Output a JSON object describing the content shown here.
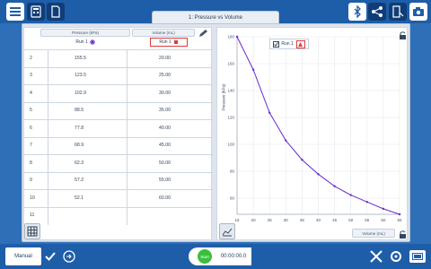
{
  "tab": {
    "title": "1: Pressure vs Volume"
  },
  "table": {
    "col1_header": "Pressure (kPa)",
    "col2_header": "Volume (mL)",
    "run1_label": "Run 1",
    "run2_label": "Run 1",
    "rows": [
      {
        "n": "2",
        "a": "155.5",
        "b": "20.00"
      },
      {
        "n": "3",
        "a": "123.5",
        "b": "25.00"
      },
      {
        "n": "4",
        "a": "102.9",
        "b": "30.00"
      },
      {
        "n": "5",
        "a": "88.5",
        "b": "35.00"
      },
      {
        "n": "6",
        "a": "77.8",
        "b": "40.00"
      },
      {
        "n": "7",
        "a": "68.9",
        "b": "45.00"
      },
      {
        "n": "8",
        "a": "62.3",
        "b": "50.00"
      },
      {
        "n": "9",
        "a": "57.2",
        "b": "55.00"
      },
      {
        "n": "10",
        "a": "52.1",
        "b": "60.00"
      },
      {
        "n": "11",
        "a": "",
        "b": ""
      }
    ]
  },
  "chart": {
    "ylabel": "Pressure (kPa)",
    "xlabel": "Volume (mL)",
    "legend": "Run 1"
  },
  "chart_data": {
    "type": "line",
    "ylabel": "Pressure (kPa)",
    "xlabel": "Volume (mL)",
    "x": [
      15,
      20,
      25,
      30,
      35,
      40,
      45,
      50,
      55,
      60,
      65
    ],
    "y": [
      180,
      155.5,
      123.5,
      102.9,
      88.5,
      77.8,
      68.9,
      62.3,
      57.2,
      52.1,
      48
    ],
    "xticks": [
      "15",
      "20",
      "25",
      "30",
      "35",
      "40",
      "45",
      "50",
      "55",
      "60",
      "65"
    ],
    "yticks": [
      "60",
      "80",
      "100",
      "120",
      "140",
      "160",
      "180"
    ],
    "xlim": [
      15,
      65
    ],
    "ylim": [
      48,
      180
    ],
    "series": [
      {
        "name": "Run 1",
        "color": "#6a2ad1"
      }
    ],
    "legend_placement": "top-left",
    "grid": true
  },
  "bottom": {
    "mode_label": "Manual",
    "start_label": "Start",
    "timer": "00:00:00.0"
  },
  "colors": {
    "brand": "#1e5ea8",
    "series": "#6a2ad1",
    "accent": "#e03a3a",
    "start": "#3bbf3b"
  }
}
